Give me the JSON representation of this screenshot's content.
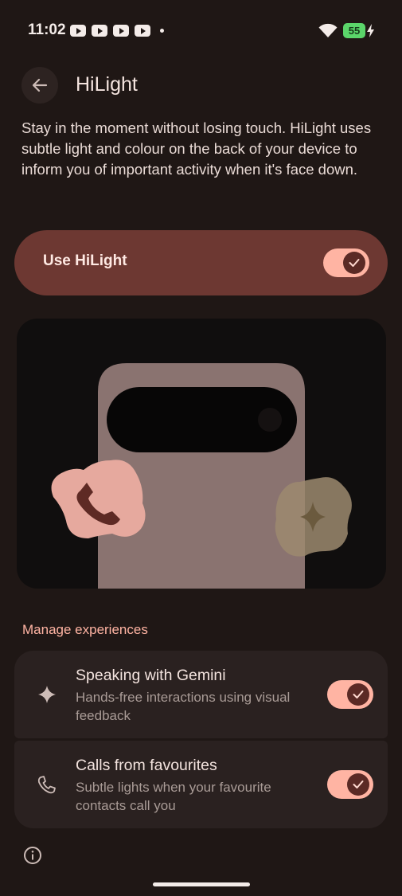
{
  "status_bar": {
    "time": "11:02",
    "notification_icons": [
      "youtube-icon",
      "youtube-icon",
      "youtube-icon",
      "youtube-icon"
    ],
    "battery_level": "55"
  },
  "header": {
    "title": "HiLight",
    "back_icon": "arrow-back-icon"
  },
  "description": "Stay in the moment without losing touch. HiLight uses subtle light and colour on the back of your device to inform you of important activity when it's face down.",
  "main_toggle": {
    "label": "Use HiLight",
    "checked": true
  },
  "section": {
    "heading": "Manage experiences"
  },
  "experiences": [
    {
      "icon": "sparkle-icon",
      "title": "Speaking with Gemini",
      "subtitle": "Hands-free interactions using visual feedback",
      "checked": true
    },
    {
      "icon": "phone-icon",
      "title": "Calls from favourites",
      "subtitle": "Subtle lights when your favourite contacts call you",
      "checked": true
    }
  ],
  "colors": {
    "background": "#1f1715",
    "accent": "#ffb4a3",
    "toggle_card": "#6d3832"
  }
}
